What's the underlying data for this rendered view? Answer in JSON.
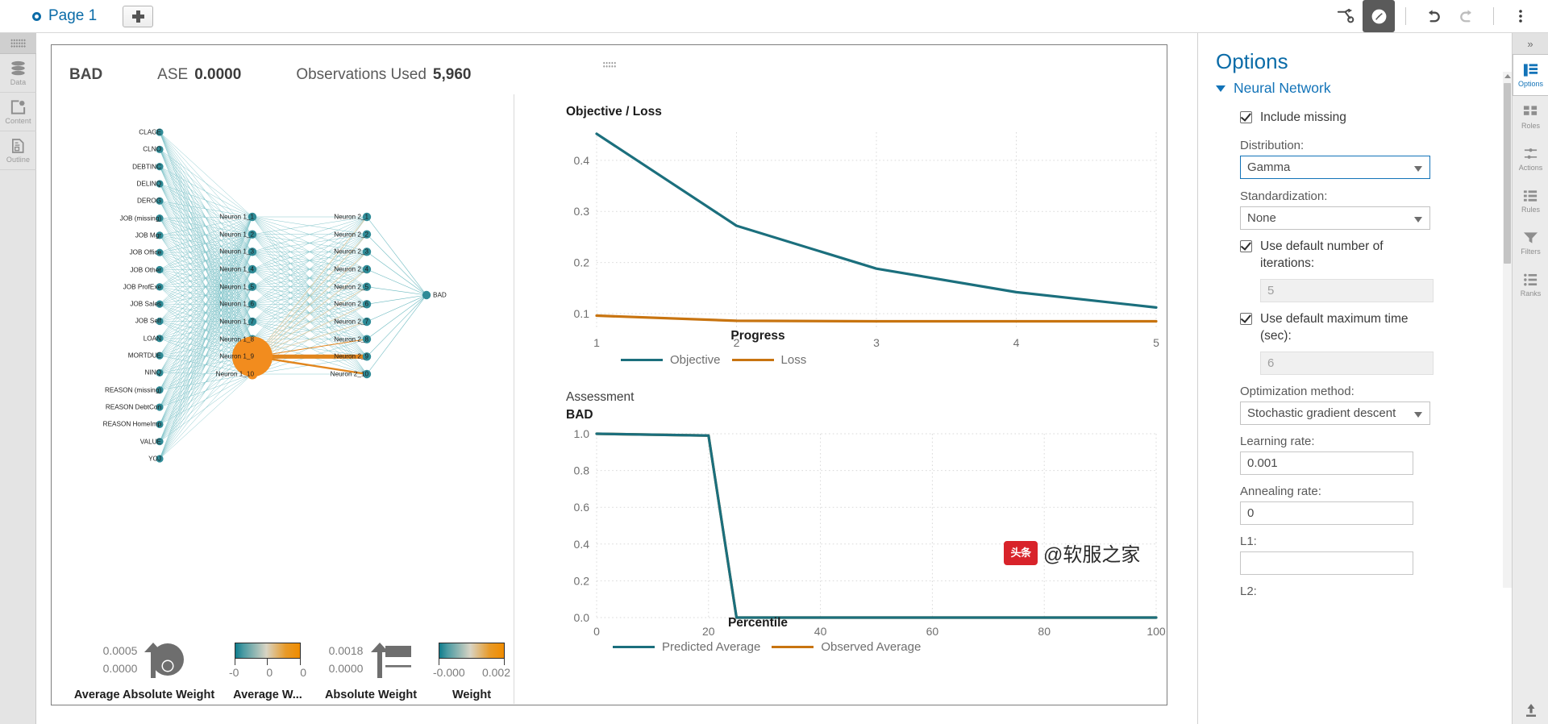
{
  "topbar": {
    "page_tab_label": "Page 1",
    "add_page_label": "+",
    "icons": [
      "branch-icon",
      "explore-active-icon",
      "undo-icon",
      "redo-icon",
      "more-vertical-icon"
    ]
  },
  "left_rail": {
    "items": [
      {
        "label": "Data",
        "icon": "database-icon"
      },
      {
        "label": "Content",
        "icon": "content-add-icon"
      },
      {
        "label": "Outline",
        "icon": "outline-document-icon"
      }
    ]
  },
  "summary": {
    "target": "BAD",
    "ase_label": "ASE",
    "ase_value": "0.0000",
    "obs_label": "Observations Used",
    "obs_value": "5,960"
  },
  "network": {
    "input_labels": [
      "CLAGE",
      "CLNO",
      "DEBTINC",
      "DELINQ",
      "DEROG",
      "JOB (missing)",
      "JOB Mgr",
      "JOB Office",
      "JOB Other",
      "JOB ProfExe",
      "JOB Sales",
      "JOB Self",
      "LOAN",
      "MORTDUE",
      "NINQ",
      "REASON (missing)",
      "REASON DebtCon",
      "REASON HomeImp",
      "VALUE",
      "YOJ"
    ],
    "hidden1_labels": [
      "Neuron 1_1",
      "Neuron 1_2",
      "Neuron 1_3",
      "Neuron 1_4",
      "Neuron 1_5",
      "Neuron 1_6",
      "Neuron 1_7",
      "Neuron 1_8",
      "Neuron 1_9",
      "Neuron 1_10"
    ],
    "hidden2_labels": [
      "Neuron 2_1",
      "Neuron 2_2",
      "Neuron 2_3",
      "Neuron 2_4",
      "Neuron 2_5",
      "Neuron 2_6",
      "Neuron 2_7",
      "Neuron 2_8",
      "Neuron 2_9",
      "Neuron 2_10"
    ],
    "output_label": "BAD",
    "highlight_node": "Neuron 1_9",
    "colors": {
      "teal": "#46a8b0",
      "orange": "#f28c1e",
      "node_teal": "#2f8b97"
    }
  },
  "network_legend": [
    {
      "title": "Average Absolute Weight",
      "type": "bubble",
      "max": "0.0005",
      "min": "0.0000"
    },
    {
      "title": "Average W...",
      "type": "gradient",
      "ticks": [
        "-0",
        "0",
        "0"
      ]
    },
    {
      "title": "Absolute Weight",
      "type": "thickness",
      "max": "0.0018",
      "min": "0.0000"
    },
    {
      "title": "Weight",
      "type": "gradient",
      "ticks": [
        "-0.000",
        "0.002"
      ]
    }
  ],
  "chart_data": [
    {
      "type": "line",
      "title": "Objective / Loss",
      "xlabel": "Progress",
      "ylabel": "",
      "x": [
        1,
        2,
        3,
        4,
        5
      ],
      "xticks": [
        "1",
        "2",
        "3",
        "4",
        "5"
      ],
      "yticks": [
        "0.1",
        "0.2",
        "0.3",
        "0.4"
      ],
      "ylim": [
        0.07,
        0.455
      ],
      "grid": true,
      "legend_position": "bottom",
      "series": [
        {
          "name": "Objective",
          "color": "#1b6f7d",
          "values": [
            0.452,
            0.272,
            0.188,
            0.142,
            0.112
          ]
        },
        {
          "name": "Loss",
          "color": "#c87410",
          "values": [
            0.096,
            0.086,
            0.085,
            0.085,
            0.085
          ]
        }
      ]
    },
    {
      "type": "line",
      "title": "Assessment",
      "subtitle": "BAD",
      "xlabel": "Percentile",
      "ylabel": "",
      "x": [
        0,
        20,
        25,
        40,
        60,
        80,
        100
      ],
      "xticks": [
        "0",
        "20",
        "40",
        "60",
        "80",
        "100"
      ],
      "yticks": [
        "0.0",
        "0.2",
        "0.4",
        "0.6",
        "0.8",
        "1.0"
      ],
      "ylim": [
        0.0,
        1.0
      ],
      "grid": true,
      "legend_position": "bottom",
      "series": [
        {
          "name": "Predicted Average",
          "color": "#1b6f7d",
          "values": [
            1.0,
            0.99,
            0.0,
            0.0,
            0.0,
            0.0,
            0.0
          ]
        },
        {
          "name": "Observed Average",
          "color": "#c87410",
          "values": [
            1.0,
            0.99,
            0.0,
            0.0,
            0.0,
            0.0,
            0.0
          ]
        }
      ]
    }
  ],
  "options_panel": {
    "title": "Options",
    "group_title": "Neural Network",
    "include_missing": {
      "label": "Include missing",
      "checked": true
    },
    "distribution": {
      "label": "Distribution:",
      "value": "Gamma"
    },
    "standardization": {
      "label": "Standardization:",
      "value": "None"
    },
    "default_iterations": {
      "label": "Use default number of iterations:",
      "checked": true,
      "value": "5"
    },
    "default_max_time": {
      "label": "Use default maximum time (sec):",
      "checked": true,
      "value": "6"
    },
    "optimization_method": {
      "label": "Optimization method:",
      "value": "Stochastic gradient descent"
    },
    "learning_rate": {
      "label": "Learning rate:",
      "value": "0.001"
    },
    "annealing_rate": {
      "label": "Annealing rate:",
      "value": "0"
    },
    "l1": {
      "label": "L1:"
    },
    "l2": {
      "label": "L2:"
    }
  },
  "right_rail": {
    "collapse_label": "»",
    "items": [
      {
        "label": "Options",
        "icon": "options-list-icon",
        "selected": true
      },
      {
        "label": "Roles",
        "icon": "roles-grid-icon",
        "selected": false
      },
      {
        "label": "Actions",
        "icon": "actions-icon",
        "selected": false
      },
      {
        "label": "Rules",
        "icon": "rules-icon",
        "selected": false
      },
      {
        "label": "Filters",
        "icon": "filters-funnel-icon",
        "selected": false
      },
      {
        "label": "Ranks",
        "icon": "ranks-icon",
        "selected": false
      }
    ]
  },
  "watermark": {
    "badge": "头条",
    "text": "@软服之家"
  }
}
